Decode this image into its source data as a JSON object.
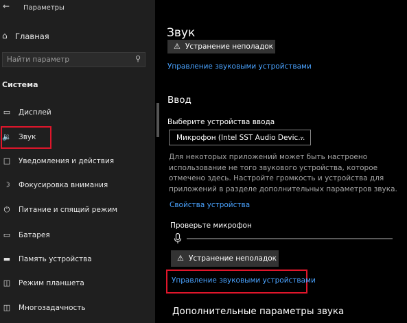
{
  "window": {
    "title": "Параметры"
  },
  "sidebar": {
    "home_label": "Главная",
    "search_placeholder": "Найти параметр",
    "section_title": "Система",
    "items": [
      {
        "label": "Дисплей",
        "icon": "monitor-icon"
      },
      {
        "label": "Звук",
        "icon": "speaker-icon",
        "active": true
      },
      {
        "label": "Уведомления и действия",
        "icon": "notification-icon"
      },
      {
        "label": "Фокусировка внимания",
        "icon": "moon-icon"
      },
      {
        "label": "Питание и спящий режим",
        "icon": "power-icon"
      },
      {
        "label": "Батарея",
        "icon": "battery-icon"
      },
      {
        "label": "Память устройства",
        "icon": "storage-icon"
      },
      {
        "label": "Режим планшета",
        "icon": "tablet-icon"
      },
      {
        "label": "Многозадачность",
        "icon": "multitask-icon"
      }
    ]
  },
  "main": {
    "title": "Звук",
    "top_troubleshoot_label": "Устранение неполадок",
    "top_manage_link": "Управление звуковыми устройствами",
    "input_heading": "Ввод",
    "input_device_label": "Выберите устройства ввода",
    "input_device_value": "Микрофон (Intel SST Audio Devic...",
    "description": "Для некоторых приложений может быть настроено использование не того звукового устройства, которое отмечено здесь. Настройте громкость и устройства для приложений в разделе дополнительных параметров звука.",
    "device_properties_link": "Свойства устройства",
    "test_mic_label": "Проверьте микрофон",
    "mic_level": 0,
    "troubleshoot_label": "Устранение неполадок",
    "manage_link": "Управление звуковыми устройствами",
    "advanced_heading": "Дополнительные параметры звука"
  },
  "colors": {
    "accent_link": "#4aa3ff",
    "highlight_box": "#e0162b"
  }
}
